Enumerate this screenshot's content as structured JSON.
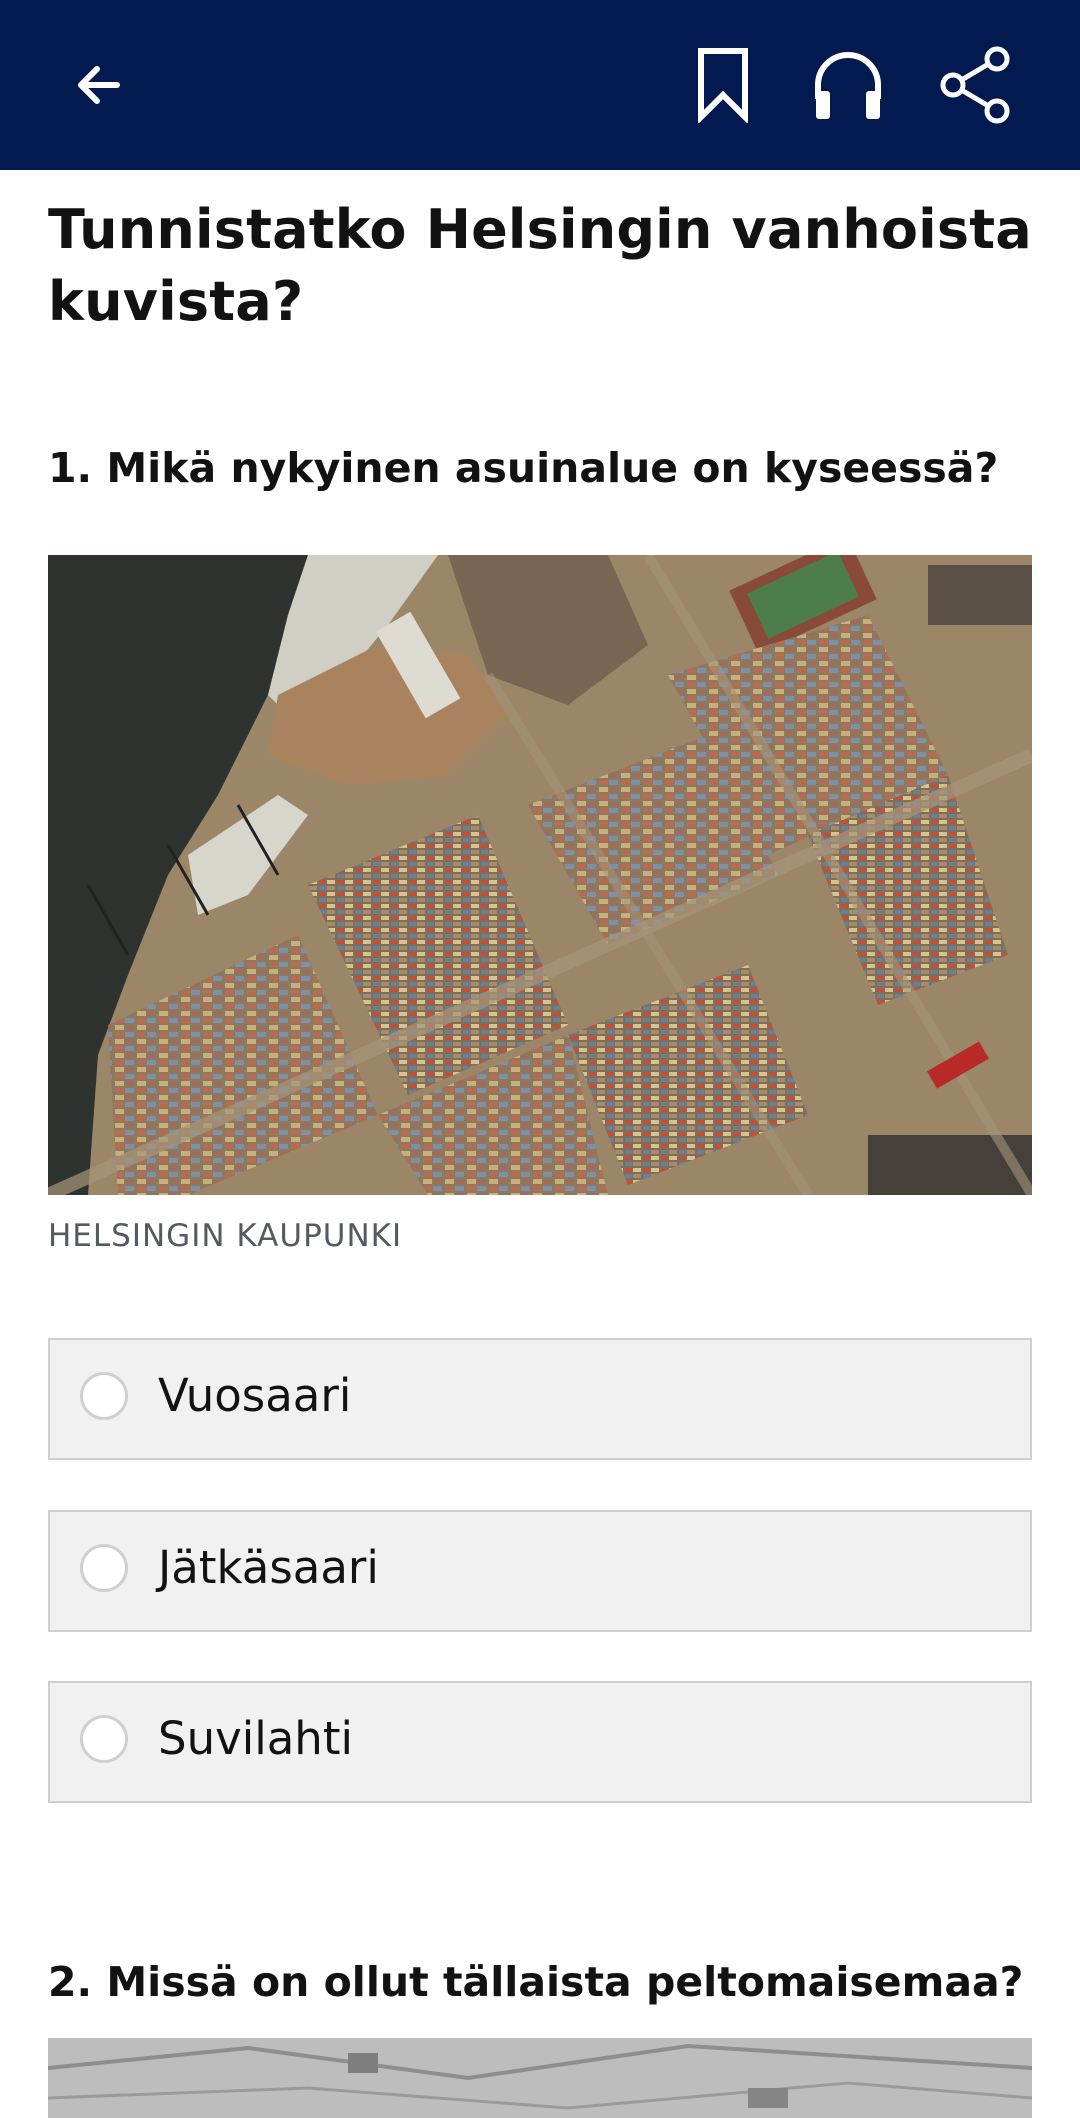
{
  "header": {
    "back_icon": "arrow-left-icon",
    "bookmark_icon": "bookmark-icon",
    "listen_icon": "headphones-icon",
    "share_icon": "share-icon",
    "background_color": "#021a4f"
  },
  "article": {
    "title": "Tunnistatko Helsingin vanhoista kuvista?"
  },
  "questions": [
    {
      "title": "1. Mikä nykyinen asuinalue on kyseessä?",
      "image_credit": "HELSINGIN KAUPUNKI",
      "options": [
        "Vuosaari",
        "Jätkäsaari",
        "Suvilahti"
      ]
    },
    {
      "title": "2. Missä on ollut tällaista peltomaisemaa?"
    }
  ]
}
